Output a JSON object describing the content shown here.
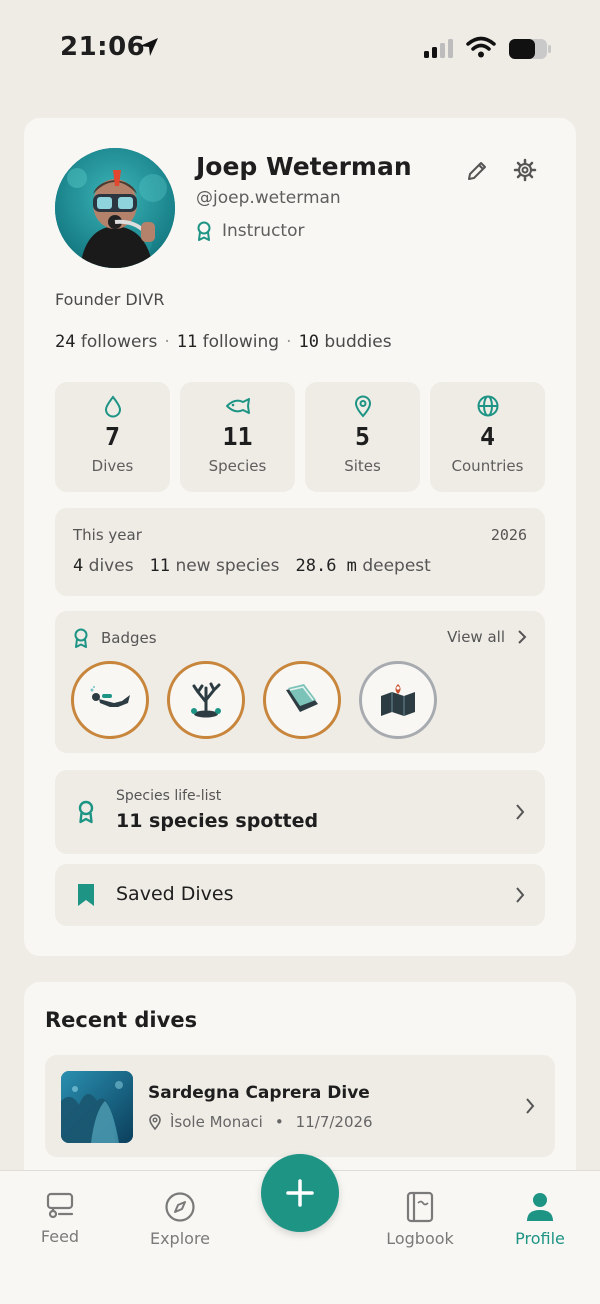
{
  "status_bar": {
    "time": "21:06"
  },
  "profile": {
    "name": "Joep Weterman",
    "handle": "@joep.weterman",
    "role": "Instructor",
    "bio": "Founder DIVR",
    "followers_count": "24",
    "followers_label": "followers",
    "following_count": "11",
    "following_label": "following",
    "buddies_count": "10",
    "buddies_label": "buddies"
  },
  "stats": [
    {
      "icon": "drop-icon",
      "value": "7",
      "label": "Dives"
    },
    {
      "icon": "fish-icon",
      "value": "11",
      "label": "Species"
    },
    {
      "icon": "pin-icon",
      "value": "5",
      "label": "Sites"
    },
    {
      "icon": "globe-icon",
      "value": "4",
      "label": "Countries"
    }
  ],
  "this_year": {
    "label": "This year",
    "year": "2026",
    "dives_value": "4",
    "dives_label": "dives",
    "species_value": "11",
    "species_label": "new species",
    "depth_value": "28.6 m",
    "depth_label": "deepest"
  },
  "badges": {
    "title": "Badges",
    "view_all": "View all",
    "items": [
      {
        "icon": "diver-icon",
        "earned": true
      },
      {
        "icon": "coral-icon",
        "earned": true
      },
      {
        "icon": "logbook-icon",
        "earned": true
      },
      {
        "icon": "map-icon",
        "earned": false
      }
    ]
  },
  "life_list": {
    "subtitle": "Species life-list",
    "title": "11 species spotted"
  },
  "saved_dives": {
    "label": "Saved Dives"
  },
  "recent": {
    "title": "Recent dives",
    "dives": [
      {
        "title": "Sardegna Caprera Dive",
        "location": "Ìsole Monaci",
        "date": "11/7/2026"
      }
    ]
  },
  "nav": {
    "feed": "Feed",
    "explore": "Explore",
    "logbook": "Logbook",
    "profile": "Profile",
    "active": "profile"
  },
  "colors": {
    "accent": "#1e9485",
    "badge_gold": "#c8853c",
    "badge_locked": "#a7abb0",
    "background": "#efece6",
    "card": "#f8f7f3"
  }
}
